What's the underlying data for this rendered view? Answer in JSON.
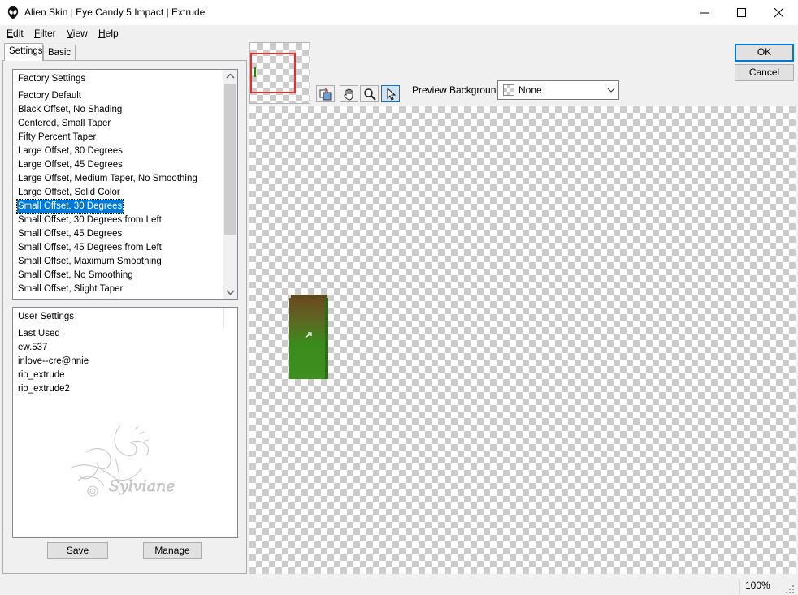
{
  "window": {
    "title": "Alien Skin | Eye Candy 5 Impact | Extrude"
  },
  "menu": [
    {
      "underline": "E",
      "rest": "dit"
    },
    {
      "underline": "F",
      "rest": "ilter"
    },
    {
      "underline": "V",
      "rest": "iew"
    },
    {
      "underline": "H",
      "rest": "elp"
    }
  ],
  "tabs": [
    "Settings",
    "Basic"
  ],
  "factory": {
    "header": "Factory Settings",
    "items": [
      "Factory Default",
      "Black Offset, No Shading",
      "Centered, Small Taper",
      "Fifty Percent Taper",
      "Large Offset, 30 Degrees",
      "Large Offset, 45 Degrees",
      "Large Offset, Medium Taper, No Smoothing",
      "Large Offset, Solid Color",
      "Small Offset, 30 Degrees",
      "Small Offset, 30 Degrees from Left",
      "Small Offset, 45 Degrees",
      "Small Offset, 45 Degrees from Left",
      "Small Offset, Maximum Smoothing",
      "Small Offset, No Smoothing",
      "Small Offset, Slight Taper"
    ],
    "selected_index": 8
  },
  "user": {
    "header": "User Settings",
    "items": [
      "Last Used",
      "ew.537",
      "inlove--cre@nnie",
      "rio_extrude",
      "rio_extrude2"
    ],
    "watermark": "Sylviane"
  },
  "buttons": {
    "save": "Save",
    "manage": "Manage",
    "ok": "OK",
    "cancel": "Cancel"
  },
  "toolbar": {
    "preview_bg_label": "Preview Background:",
    "preview_bg_value": "None",
    "tools": [
      "compare-tool-icon",
      "hand-tool-icon",
      "zoom-tool-icon",
      "pointer-tool-icon"
    ]
  },
  "status": {
    "zoom": "100%"
  },
  "colors": {
    "selection": "#0078d7",
    "extrude_top": "#6b4a20",
    "extrude_bottom": "#3a8a1c",
    "navigator_frame": "#e03030"
  }
}
